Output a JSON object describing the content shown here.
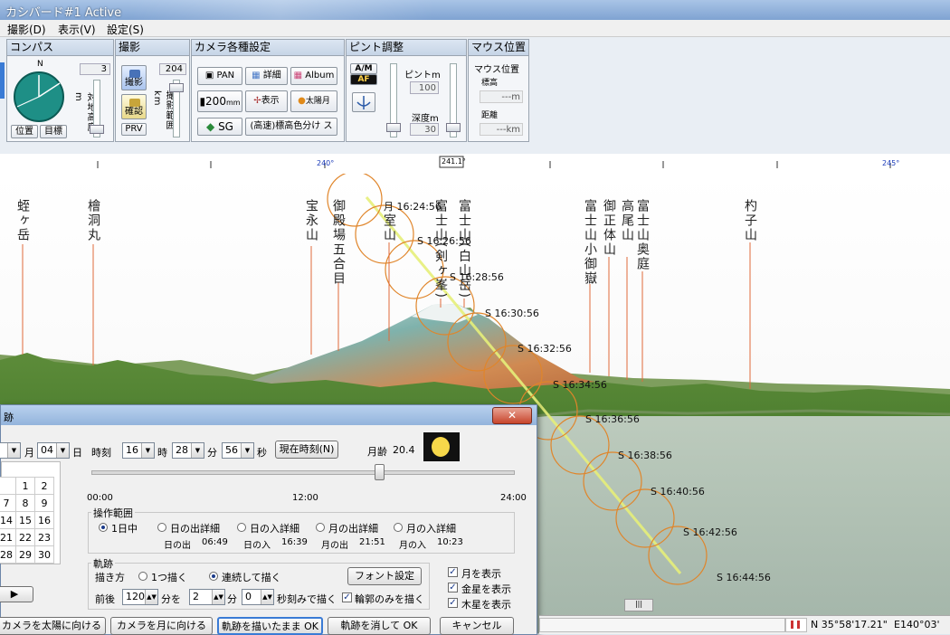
{
  "window": {
    "title": "カシバード#1 Active"
  },
  "menu": {
    "items": [
      "撮影(D)",
      "表示(V)",
      "設定(S)"
    ]
  },
  "toolbar": {
    "compass": {
      "title": "コンパス",
      "north": "N",
      "value": "3",
      "label": "対地高度m",
      "btn_pos": "位置",
      "btn_target": "目標"
    },
    "shoot": {
      "title": "撮影",
      "value": "204",
      "btn_shoot": "撮影",
      "btn_check": "確認",
      "btn_prv": "PRV",
      "label": "撮影範囲km"
    },
    "camera": {
      "title": "カメラ各種設定",
      "pan": "PAN",
      "detail": "詳細",
      "album": "Album",
      "lens": "200",
      "lens_unit": "mm",
      "display": "表示",
      "sunmoon": "太陽月",
      "sg": "SG",
      "mode": "(高速)標高色分け ス"
    },
    "focus": {
      "title": "ピント調整",
      "am": "A/M",
      "af": "AF",
      "pinto_label": "ピントm",
      "pinto_val": "100",
      "depth_label": "深度m",
      "depth_val": "30"
    },
    "mouse": {
      "title": "マウス位置",
      "alt_title": "マウス位置",
      "alt_label": "標高",
      "alt_val": "---m",
      "dist_label": "距離",
      "dist_val": "---km"
    }
  },
  "ruler": {
    "ticks": [
      "240°",
      "241.1°",
      "245°"
    ]
  },
  "mountains": [
    {
      "name": "蛭ヶ岳"
    },
    {
      "name": "檜洞丸"
    },
    {
      "name": "宝永山"
    },
    {
      "name": "御殿場五合目"
    },
    {
      "name": "室山"
    },
    {
      "name": "富士山(剣ヶ峯)"
    },
    {
      "name": "富士山(白山岳)"
    },
    {
      "name": "富士山小御嶽"
    },
    {
      "name": "御正体山"
    },
    {
      "name": "高尾山"
    },
    {
      "name": "富士山奥庭"
    },
    {
      "name": "杓子山"
    }
  ],
  "sun_track": [
    {
      "label": "月 16:24:56"
    },
    {
      "label": "S 16:26:56"
    },
    {
      "label": "S 16:28:56"
    },
    {
      "label": "S 16:30:56"
    },
    {
      "label": "S 16:32:56"
    },
    {
      "label": "S 16:34:56"
    },
    {
      "label": "S 16:36:56"
    },
    {
      "label": "S 16:38:56"
    },
    {
      "label": "S 16:40:56"
    },
    {
      "label": "S 16:42:56"
    },
    {
      "label": "S 16:44:56"
    }
  ],
  "dialog": {
    "title": "跡",
    "month_label": "月",
    "day_val": "04",
    "day_label": "日",
    "time_label": "時刻",
    "hour_val": "16",
    "hour_label": "時",
    "min_val": "28",
    "min_label": "分",
    "sec_val": "56",
    "sec_label": "秒",
    "now_btn": "現在時刻(N)",
    "moon_age_label": "月齢",
    "moon_age_val": "20.4",
    "timeline": {
      "start": "00:00",
      "mid": "12:00",
      "end": "24:00"
    },
    "calendar": [
      [
        "",
        "",
        "1",
        "2"
      ],
      [
        "7",
        "",
        "8",
        "9"
      ],
      [
        "14",
        "",
        "15",
        "16"
      ],
      [
        "21",
        "",
        "22",
        "23"
      ],
      [
        "28",
        "",
        "29",
        "30"
      ]
    ],
    "calendar_rows": [
      [
        "",
        "1",
        "2"
      ],
      [
        "7",
        "8",
        "9"
      ],
      [
        "14",
        "15",
        "16"
      ],
      [
        "21",
        "22",
        "23"
      ],
      [
        "28",
        "29",
        "30"
      ]
    ],
    "range_title": "操作範囲",
    "range_opts": [
      "1日中",
      "日の出詳細",
      "日の入詳細",
      "月の出詳細",
      "月の入詳細"
    ],
    "sunrise_label": "日の出",
    "sunrise_val": "06:49",
    "sunset_label": "日の入",
    "sunset_val": "16:39",
    "moonrise_label": "月の出",
    "moonrise_val": "21:51",
    "moonset_label": "月の入",
    "moonset_val": "10:23",
    "track_title": "軌跡",
    "draw_label": "描き方",
    "draw_once": "1つ描く",
    "draw_cont": "連続して描く",
    "font_btn": "フォント設定",
    "range_label": "前後",
    "range_val": "120",
    "range_unit": "分を",
    "step_val": "2",
    "step_unit": "分",
    "sec_step_val": "0",
    "sec_step_unit": "秒刻みで描く",
    "outline_only": "輪郭のみを描く",
    "show_moon": "月を表示",
    "show_venus": "金星を表示",
    "show_jupiter": "木星を表示",
    "btn_sun": "カメラを太陽に向ける",
    "btn_moon": "カメラを月に向ける",
    "btn_ok_keep": "軌跡を描いたまま OK",
    "btn_ok_clear": "軌跡を消して OK",
    "btn_cancel": "キャンセル"
  },
  "status": {
    "lat": "N 35°58'17.21\"",
    "lon": "E140°03'"
  }
}
